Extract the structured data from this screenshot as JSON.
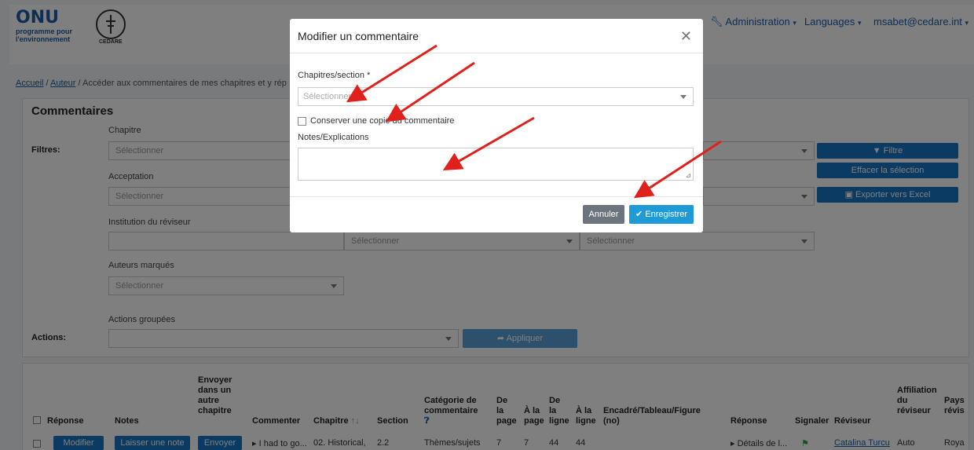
{
  "navbar": {
    "logo_onu": "ONU",
    "logo_onu_sub1": "programme pour",
    "logo_onu_sub2": "l'environnement",
    "logo_cedare": "CEDARE",
    "admin": "Administration",
    "languages": "Languages",
    "user": "msabet@cedare.int"
  },
  "breadcrumb": {
    "home": "Accueil",
    "author": "Auteur",
    "current": "Accéder aux commentaires de mes chapitres et y rép"
  },
  "filters": {
    "title": "Commentaires",
    "filters_label": "Filtres:",
    "chapitre_label": "Chapitre",
    "acceptation_label": "Acceptation",
    "institution_label": "Institution du réviseur",
    "auteurs_label": "Auteurs marqués",
    "actions_groupees_label": "Actions groupées",
    "actions_label": "Actions:",
    "placeholder": "Sélectionner",
    "filter_button": "Filtre",
    "clear_button": "Effacer la sélection",
    "export_button": "Exporter vers Excel",
    "apply_button": "Appliquer"
  },
  "table": {
    "headers": {
      "reponse": "Réponse",
      "notes": "Notes",
      "envoyer": [
        "Envoyer",
        "dans un",
        "autre",
        "chapitre"
      ],
      "commenter": "Commenter",
      "chapitre": "Chapitre",
      "section": "Section",
      "categorie": [
        "Catégorie de",
        "commentaire"
      ],
      "de_la_page": [
        "De",
        "la",
        "page"
      ],
      "a_la_page": [
        "À la",
        "page"
      ],
      "de_la_ligne": [
        "De",
        "la",
        "ligne"
      ],
      "a_la_ligne": [
        "À la",
        "ligne"
      ],
      "encadre": [
        "Encadré/Tableau/Figure",
        "(no)"
      ],
      "reponse2": "Réponse",
      "signaler": "Signaler",
      "reviseur": "Réviseur",
      "affiliation": [
        "Affiliation",
        "du",
        "réviseur"
      ],
      "pays": [
        "Pays",
        "révis"
      ]
    },
    "row": {
      "modifier": "Modifier",
      "laisser_note": "Laisser une note",
      "envoyer": "Envoyer",
      "commenter": "I had to go...",
      "chapitre": "02. Historical,",
      "section": "2.2",
      "categorie": "Thèmes/sujets",
      "de_page": "7",
      "a_page": "7",
      "de_ligne": "44",
      "a_ligne": "44",
      "reponse": "Détails de l...",
      "reviseur": "Catalina Turcu",
      "affiliation": "Auto",
      "pays": "Roya"
    }
  },
  "modal": {
    "title": "Modifier un commentaire",
    "chapitres_label": "Chapitres/section *",
    "chapitres_placeholder": "Sélectionner",
    "conserver_label": "Conserver une copie du commentaire",
    "notes_label": "Notes/Explications",
    "cancel": "Annuler",
    "save": "Enregistrer"
  },
  "colors": {
    "primary": "#1776c5",
    "save": "#1e9bd7",
    "annotation": "#e0201b"
  }
}
